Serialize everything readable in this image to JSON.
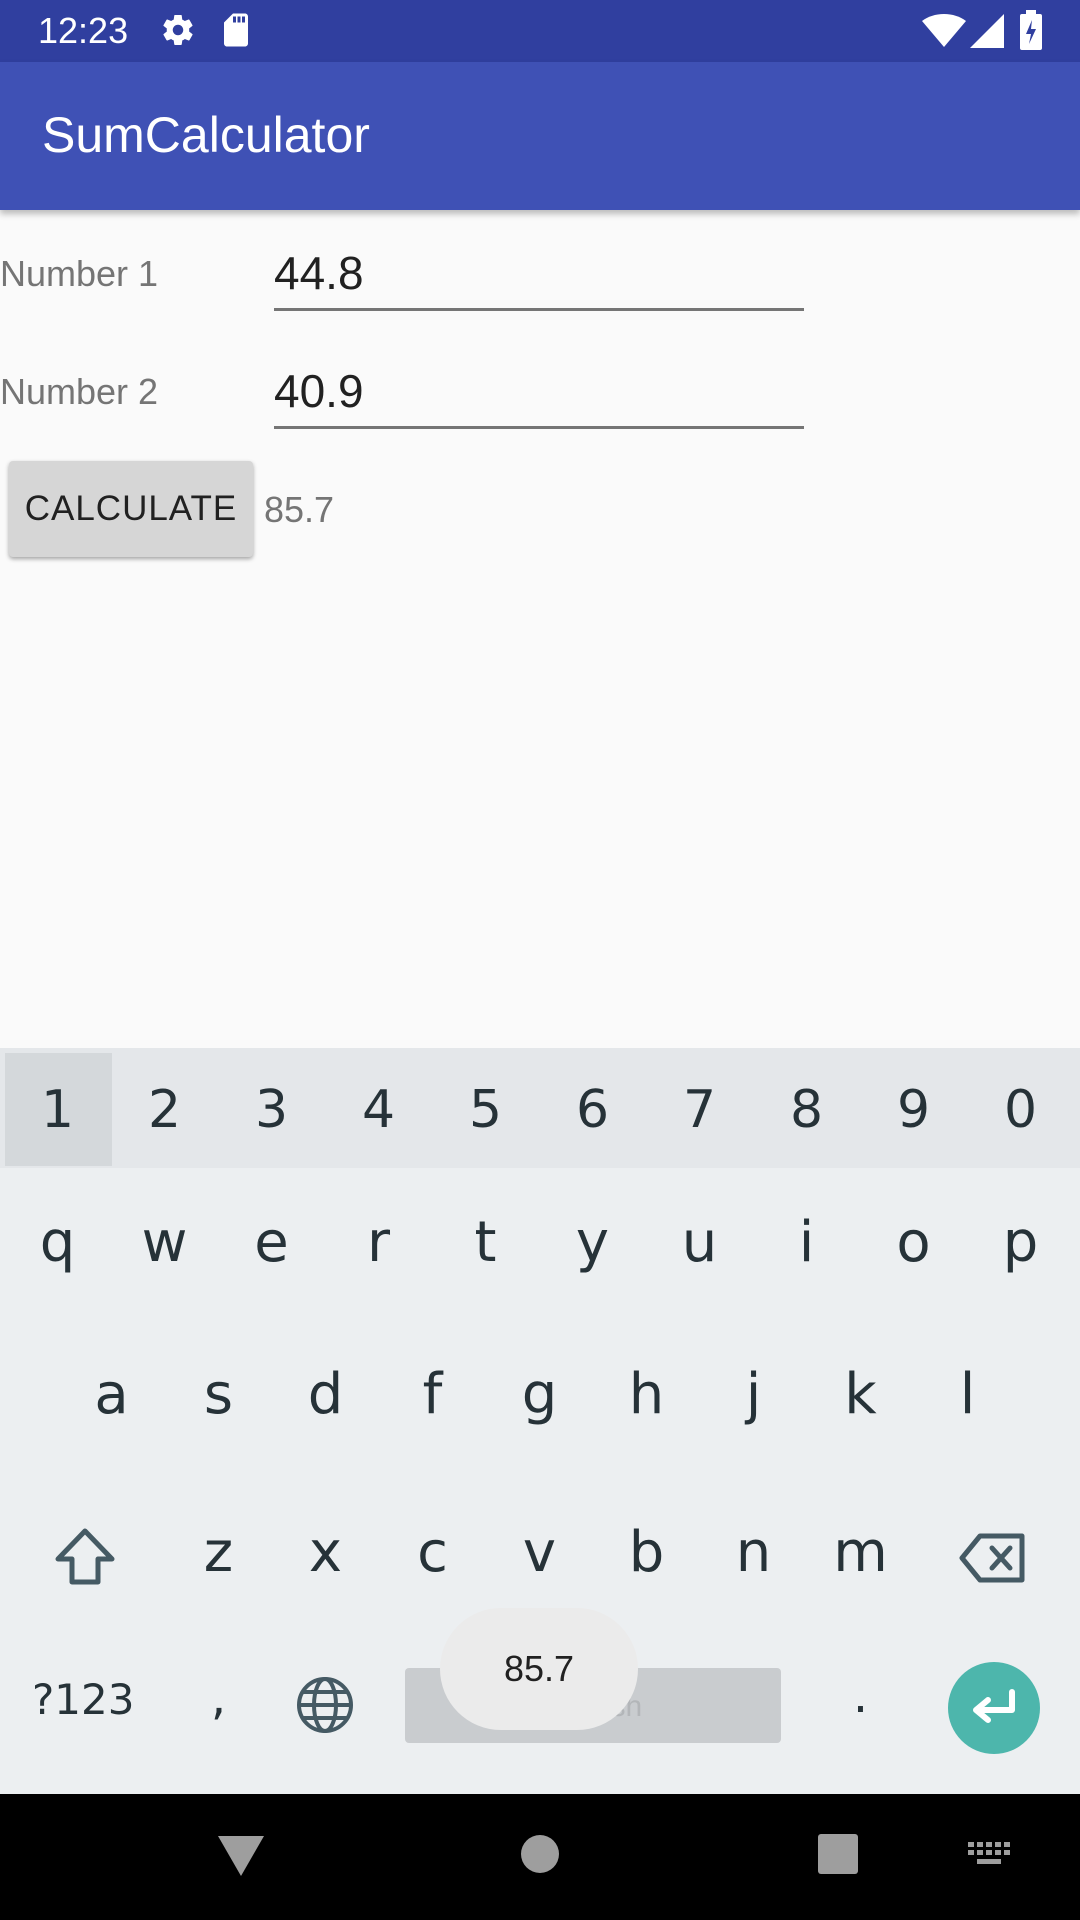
{
  "status_bar": {
    "time": "12:23"
  },
  "app_bar": {
    "title": "SumCalculator"
  },
  "form": {
    "number1_label": "Number 1",
    "number1_value": "44.8",
    "number2_label": "Number 2",
    "number2_value": "40.9",
    "calculate_label": "CALCULATE",
    "result": "85.7"
  },
  "keyboard": {
    "numbers": [
      "1",
      "2",
      "3",
      "4",
      "5",
      "6",
      "7",
      "8",
      "9",
      "0"
    ],
    "row1": [
      "q",
      "w",
      "e",
      "r",
      "t",
      "y",
      "u",
      "i",
      "o",
      "p"
    ],
    "row2": [
      "a",
      "s",
      "d",
      "f",
      "g",
      "h",
      "j",
      "k",
      "l"
    ],
    "row3": [
      "z",
      "x",
      "c",
      "v",
      "b",
      "n",
      "m"
    ],
    "symbols_label": "?123",
    "comma": ",",
    "period": ".",
    "space_label": "English"
  },
  "toast": {
    "text": "85.7"
  },
  "colors": {
    "status_bar": "#303f9f",
    "app_bar": "#3f51b5",
    "enter_key": "#4db6ac"
  }
}
